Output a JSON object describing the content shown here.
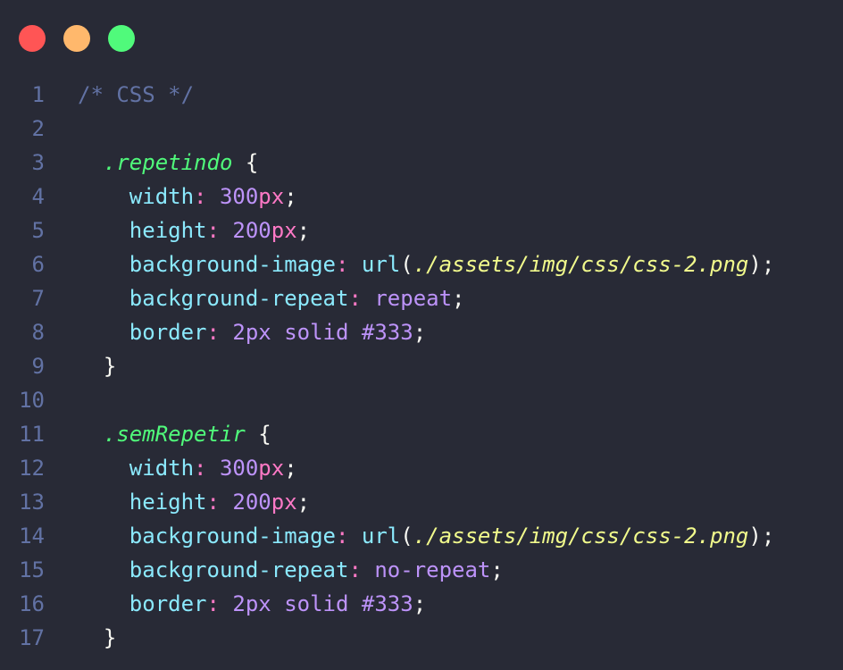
{
  "window": {
    "controls": [
      {
        "name": "close",
        "color": "#ff5555"
      },
      {
        "name": "minimize",
        "color": "#ffb86c"
      },
      {
        "name": "maximize",
        "color": "#50fa7b"
      }
    ]
  },
  "colors": {
    "background": "#282a36",
    "line_number": "#6272a4",
    "comment": "#6272a4",
    "selector": "#50fa7b",
    "property": "#8be9fd",
    "punctuation": "#ff79c6",
    "value": "#bd93f9",
    "string": "#f1fa8c",
    "text": "#f8f8f2"
  },
  "code": {
    "lines": [
      {
        "n": "1",
        "tokens": [
          {
            "t": "/* CSS */",
            "c": "comment"
          }
        ]
      },
      {
        "n": "2",
        "tokens": []
      },
      {
        "n": "3",
        "tokens": [
          {
            "t": "  "
          },
          {
            "t": ".repetindo",
            "c": "selector"
          },
          {
            "t": " {",
            "c": "brace"
          }
        ]
      },
      {
        "n": "4",
        "tokens": [
          {
            "t": "    "
          },
          {
            "t": "width",
            "c": "prop"
          },
          {
            "t": ":",
            "c": "colon"
          },
          {
            "t": " 300",
            "c": "number"
          },
          {
            "t": "px",
            "c": "unit"
          },
          {
            "t": ";",
            "c": "semi"
          }
        ]
      },
      {
        "n": "5",
        "tokens": [
          {
            "t": "    "
          },
          {
            "t": "height",
            "c": "prop"
          },
          {
            "t": ":",
            "c": "colon"
          },
          {
            "t": " 200",
            "c": "number"
          },
          {
            "t": "px",
            "c": "unit"
          },
          {
            "t": ";",
            "c": "semi"
          }
        ]
      },
      {
        "n": "6",
        "tokens": [
          {
            "t": "    "
          },
          {
            "t": "background-image",
            "c": "prop"
          },
          {
            "t": ":",
            "c": "colon"
          },
          {
            "t": " url",
            "c": "func"
          },
          {
            "t": "(",
            "c": "paren"
          },
          {
            "t": "./assets/img/css/css-2.png",
            "c": "string"
          },
          {
            "t": ")",
            "c": "paren"
          },
          {
            "t": ";",
            "c": "semi"
          }
        ]
      },
      {
        "n": "7",
        "tokens": [
          {
            "t": "    "
          },
          {
            "t": "background-repeat",
            "c": "prop"
          },
          {
            "t": ":",
            "c": "colon"
          },
          {
            "t": " repeat",
            "c": "keyword"
          },
          {
            "t": ";",
            "c": "semi"
          }
        ]
      },
      {
        "n": "8",
        "tokens": [
          {
            "t": "    "
          },
          {
            "t": "border",
            "c": "prop"
          },
          {
            "t": ":",
            "c": "colon"
          },
          {
            "t": " 2px",
            "c": "number"
          },
          {
            "t": " solid",
            "c": "keyword"
          },
          {
            "t": " #333",
            "c": "hash"
          },
          {
            "t": ";",
            "c": "semi"
          }
        ]
      },
      {
        "n": "9",
        "tokens": [
          {
            "t": "  "
          },
          {
            "t": "}",
            "c": "brace"
          }
        ]
      },
      {
        "n": "10",
        "tokens": []
      },
      {
        "n": "11",
        "tokens": [
          {
            "t": "  "
          },
          {
            "t": ".semRepetir",
            "c": "selector"
          },
          {
            "t": " {",
            "c": "brace"
          }
        ]
      },
      {
        "n": "12",
        "tokens": [
          {
            "t": "    "
          },
          {
            "t": "width",
            "c": "prop"
          },
          {
            "t": ":",
            "c": "colon"
          },
          {
            "t": " 300",
            "c": "number"
          },
          {
            "t": "px",
            "c": "unit"
          },
          {
            "t": ";",
            "c": "semi"
          }
        ]
      },
      {
        "n": "13",
        "tokens": [
          {
            "t": "    "
          },
          {
            "t": "height",
            "c": "prop"
          },
          {
            "t": ":",
            "c": "colon"
          },
          {
            "t": " 200",
            "c": "number"
          },
          {
            "t": "px",
            "c": "unit"
          },
          {
            "t": ";",
            "c": "semi"
          }
        ]
      },
      {
        "n": "14",
        "tokens": [
          {
            "t": "    "
          },
          {
            "t": "background-image",
            "c": "prop"
          },
          {
            "t": ":",
            "c": "colon"
          },
          {
            "t": " url",
            "c": "func"
          },
          {
            "t": "(",
            "c": "paren"
          },
          {
            "t": "./assets/img/css/css-2.png",
            "c": "string"
          },
          {
            "t": ")",
            "c": "paren"
          },
          {
            "t": ";",
            "c": "semi"
          }
        ]
      },
      {
        "n": "15",
        "tokens": [
          {
            "t": "    "
          },
          {
            "t": "background-repeat",
            "c": "prop"
          },
          {
            "t": ":",
            "c": "colon"
          },
          {
            "t": " no-repeat",
            "c": "keyword"
          },
          {
            "t": ";",
            "c": "semi"
          }
        ]
      },
      {
        "n": "16",
        "tokens": [
          {
            "t": "    "
          },
          {
            "t": "border",
            "c": "prop"
          },
          {
            "t": ":",
            "c": "colon"
          },
          {
            "t": " 2px",
            "c": "number"
          },
          {
            "t": " solid",
            "c": "keyword"
          },
          {
            "t": " #333",
            "c": "hash"
          },
          {
            "t": ";",
            "c": "semi"
          }
        ]
      },
      {
        "n": "17",
        "tokens": [
          {
            "t": "  "
          },
          {
            "t": "}",
            "c": "brace"
          }
        ]
      }
    ]
  }
}
